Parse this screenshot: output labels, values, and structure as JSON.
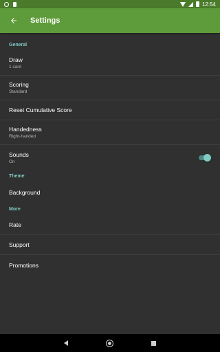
{
  "status_bar": {
    "time": "12:54"
  },
  "app_bar": {
    "title": "Settings"
  },
  "sections": {
    "general": {
      "header": "General",
      "draw": {
        "title": "Draw",
        "summary": "1 card"
      },
      "scoring": {
        "title": "Scoring",
        "summary": "Standard"
      },
      "reset": {
        "title": "Reset Cumulative Score"
      },
      "handedness": {
        "title": "Handedness",
        "summary": "Right-handed"
      },
      "sounds": {
        "title": "Sounds",
        "summary": "On",
        "enabled": true
      }
    },
    "theme": {
      "header": "Theme",
      "background": {
        "title": "Background"
      }
    },
    "more": {
      "header": "More",
      "rate": {
        "title": "Rate"
      },
      "support": {
        "title": "Support"
      },
      "promotions": {
        "title": "Promotions"
      }
    }
  },
  "colors": {
    "status_bar": "#4a7b2b",
    "app_bar": "#5e9b3a",
    "background": "#303030",
    "accent": "#80cbc4"
  },
  "icons": [
    "ring-icon",
    "sim-card-icon",
    "wifi-icon",
    "signal-icon",
    "battery-icon",
    "back-arrow-icon",
    "nav-back-icon",
    "nav-home-icon",
    "nav-recents-icon"
  ]
}
